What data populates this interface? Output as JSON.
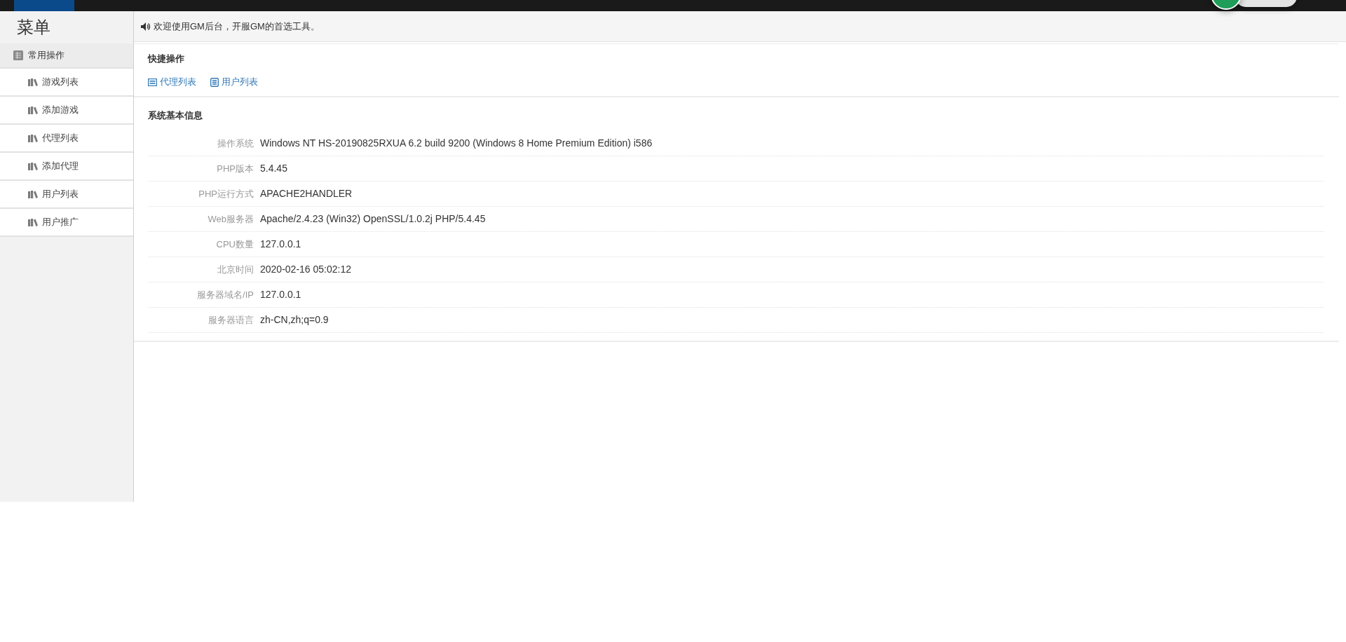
{
  "sidebar": {
    "title": "菜单",
    "menu": [
      {
        "label": "常用操作",
        "children": [
          {
            "label": "游戏列表",
            "selected": false
          },
          {
            "label": "添加游戏",
            "selected": false
          },
          {
            "label": "代理列表",
            "selected": false
          },
          {
            "label": "添加代理",
            "selected": false
          },
          {
            "label": "用户列表",
            "selected": false
          },
          {
            "label": "用户推广",
            "selected": false
          }
        ]
      }
    ]
  },
  "notice": {
    "text": "欢迎使用GM后台，开服GM的首选工具。"
  },
  "quick_actions": {
    "title": "快捷操作",
    "links": [
      "代理列表",
      "用户列表"
    ]
  },
  "system_info": {
    "title": "系统基本信息",
    "rows": [
      {
        "label": "操作系统",
        "value": "Windows NT HS-20190825RXUA 6.2 build 9200 (Windows 8 Home Premium Edition) i586"
      },
      {
        "label": "PHP版本",
        "value": "5.4.45"
      },
      {
        "label": "PHP运行方式",
        "value": "APACHE2HANDLER"
      },
      {
        "label": "Web服务器",
        "value": "Apache/2.4.23 (Win32) OpenSSL/1.0.2j PHP/5.4.45"
      },
      {
        "label": "CPU数量",
        "value": "127.0.0.1"
      },
      {
        "label": "北京时间",
        "value": "2020-02-16 05:02:12"
      },
      {
        "label": "服务器域名/IP",
        "value": "127.0.0.1"
      },
      {
        "label": "服务器语言",
        "value": "zh-CN,zh;q=0.9"
      }
    ]
  }
}
